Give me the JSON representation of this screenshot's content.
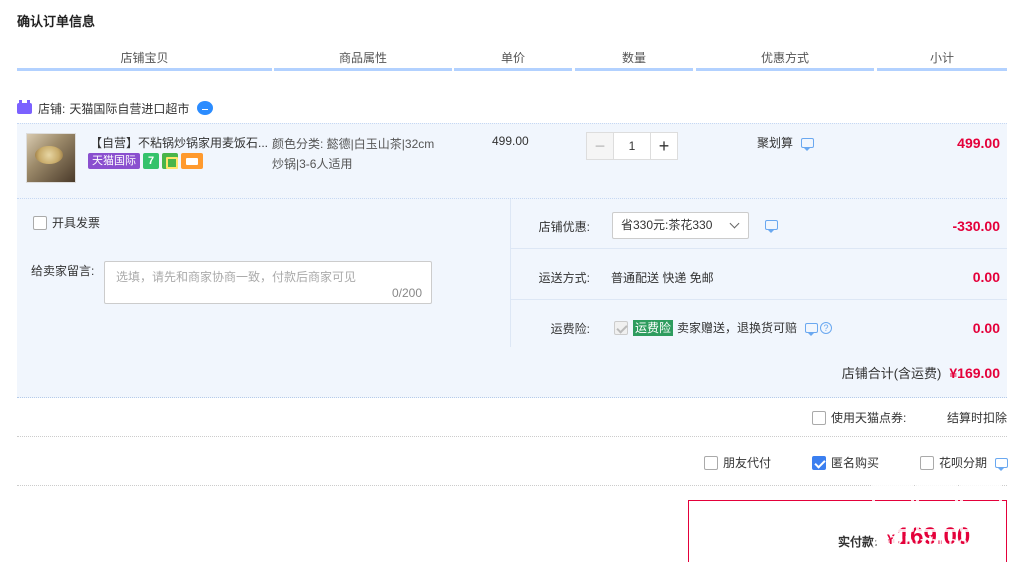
{
  "page": {
    "title": "确认订单信息"
  },
  "columns": [
    "店铺宝贝",
    "商品属性",
    "单价",
    "数量",
    "优惠方式",
    "小计"
  ],
  "shop": {
    "prefix": "店铺:",
    "name": "天猫国际自营进口超市"
  },
  "item": {
    "name": "【自营】不粘锅炒锅家用麦饭石...",
    "badge": "天猫国际",
    "seven_badge": "7",
    "attr_line1": "颜色分类: 懿德|白玉山茶|32cm",
    "attr_line2": "炒锅|3-6人适用",
    "price": "499.00",
    "qty_minus": "−",
    "qty": "1",
    "qty_plus": "+",
    "promo": "聚划算",
    "subtotal": "499.00"
  },
  "options": {
    "invoice": "开具发票",
    "memo_label": "给卖家留言:",
    "memo_placeholder": "选填，请先和商家协商一致，付款后商家可见",
    "memo_count": "0/200"
  },
  "discounts": {
    "shop_label": "店铺优惠:",
    "shop_select": "省330元:茶花330",
    "shop_amount": "-330.00",
    "ship_label": "运送方式:",
    "ship_text": "普通配送 快递 免邮",
    "ship_amount": "0.00",
    "ins_label": "运费险:",
    "ins_tag": "运费险",
    "ins_text": "卖家赠送，退换货可赔",
    "ins_amount": "0.00",
    "help_glyph": "?"
  },
  "shop_total": {
    "label": "店铺合计(含运费)",
    "value": "¥169.00"
  },
  "tmall_points": {
    "label": "使用天猫点券:",
    "note": "结算时扣除"
  },
  "extras": [
    {
      "label": "朋友代付",
      "checked": false
    },
    {
      "label": "匿名购买",
      "checked": true
    },
    {
      "label": "花呗分期",
      "checked": false
    }
  ],
  "payment": {
    "label": "实付款:",
    "currency": "¥",
    "amount": "169.00"
  },
  "watermark": {
    "text": "zhizhizhi.com"
  },
  "colors": {
    "accent_red": "#e4003a",
    "header_line": "#b2d1ff",
    "panel_bg": "#f1f6fd"
  }
}
